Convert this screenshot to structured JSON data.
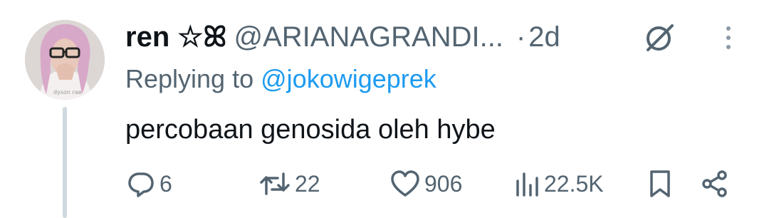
{
  "tweet": {
    "display_name": "ren ☆ꕤ",
    "handle": "@ARIANAGRANDI...",
    "separator": "·",
    "time": "2d",
    "replying_prefix": "Replying to",
    "replying_to": "@jokowigeprek",
    "text": "percobaan genosida oleh hybe",
    "avatar_text": "dyson rae"
  },
  "actions": {
    "replies": "6",
    "retweets": "22",
    "likes": "906",
    "views": "22.5K"
  },
  "colors": {
    "text_primary": "#0f1419",
    "text_secondary": "#536471",
    "link": "#1d9bf0",
    "thread_line": "#cfd9de"
  },
  "icons": [
    "grok-icon",
    "more-icon",
    "reply-icon",
    "retweet-icon",
    "like-icon",
    "views-icon",
    "bookmark-icon",
    "share-icon"
  ]
}
